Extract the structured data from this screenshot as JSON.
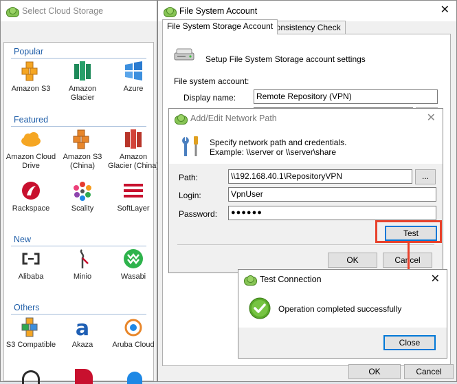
{
  "select_window": {
    "title": "Select Cloud Storage",
    "sections": {
      "popular": "Popular",
      "featured": "Featured",
      "new": "New",
      "others": "Others"
    },
    "tiles": {
      "amazon_s3": "Amazon S3",
      "amazon_glacier": "Amazon Glacier",
      "azure": "Azure",
      "amazon_cloud_drive": "Amazon Cloud Drive",
      "amazon_s3_china": "Amazon S3 (China)",
      "amazon_glacier_china": "Amazon Glacier (China)",
      "rackspace": "Rackspace",
      "scality": "Scality",
      "softlayer": "SoftLayer",
      "alibaba": "Alibaba",
      "minio": "Minio",
      "wasabi": "Wasabi",
      "s3_compatible": "S3 Compatible",
      "akaza": "Akaza",
      "aruba_cloud": "Aruba Cloud"
    }
  },
  "fsa_window": {
    "title": "File System Account",
    "tabs": [
      "File System Storage Account",
      "Consistency Check"
    ],
    "setup_text": "Setup File System Storage account settings",
    "section_label": "File system account:",
    "display_name_label": "Display name:",
    "display_name_value": "Remote Repository (VPN)",
    "ok_label": "OK",
    "cancel_label": "Cancel"
  },
  "net_dialog": {
    "title": "Add/Edit Network Path",
    "info_line1": "Specify network path and credentials.",
    "info_line2": "Example: \\\\server or \\\\server\\share",
    "path_label": "Path:",
    "path_value": "\\\\192.168.40.1\\RepositoryVPN",
    "browse_label": "...",
    "login_label": "Login:",
    "login_value": "VpnUser",
    "password_label": "Password:",
    "password_value": "●●●●●●",
    "test_label": "Test",
    "ok_label": "OK",
    "cancel_label": "Cancel"
  },
  "test_dialog": {
    "title": "Test Connection",
    "message": "Operation completed successfully",
    "close_label": "Close"
  },
  "colors": {
    "accent": "#0078d7",
    "section": "#1f5ea8",
    "highlight": "#e8412b",
    "success": "#5aaa2a"
  }
}
